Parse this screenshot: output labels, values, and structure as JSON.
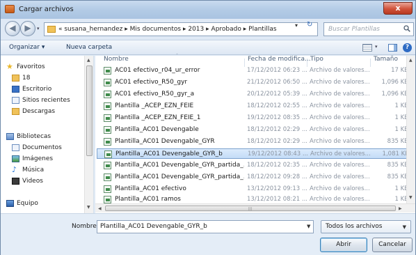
{
  "window": {
    "title": "Cargar archivos",
    "close_glyph": "x"
  },
  "address": {
    "crumbs": [
      "« susana_hernandez",
      "Mis documentos",
      "2013",
      "Aprobado",
      "Plantillas"
    ],
    "separator": "▸",
    "search_placeholder": "Buscar Plantillas"
  },
  "toolbar": {
    "organize_label": "Organizar ▾",
    "new_folder_label": "Nueva carpeta",
    "help_glyph": "?"
  },
  "nav": [
    {
      "label": "Favoritos",
      "icon": "star-icon"
    },
    {
      "label": "18",
      "icon": "folder-icon"
    },
    {
      "label": "Escritorio",
      "icon": "desktop-icon"
    },
    {
      "label": "Sitios recientes",
      "icon": "recent-places-icon"
    },
    {
      "label": "Descargas",
      "icon": "downloads-icon"
    },
    {
      "label": "Bibliotecas",
      "icon": "libraries-icon"
    },
    {
      "label": "Documentos",
      "icon": "documents-icon"
    },
    {
      "label": "Imágenes",
      "icon": "pictures-icon"
    },
    {
      "label": "Música",
      "icon": "music-icon"
    },
    {
      "label": "Videos",
      "icon": "videos-icon"
    },
    {
      "label": "Equipo",
      "icon": "computer-icon"
    }
  ],
  "columns": {
    "name": "Nombre",
    "date": "Fecha de modifica...",
    "type": "Tipo",
    "size": "Tamaño"
  },
  "files": [
    {
      "name": "AC01 efectivo_r04_ur_error",
      "date": "17/12/2012 06:23 ...",
      "type": "Archivo de valores...",
      "size": "17 KB"
    },
    {
      "name": "AC01 efectivo_R50_gyr",
      "date": "21/12/2012 06:50 ...",
      "type": "Archivo de valores...",
      "size": "1,096 KB"
    },
    {
      "name": "AC01 efectivo_R50_gyr_a",
      "date": "20/12/2012 05:39 ...",
      "type": "Archivo de valores...",
      "size": "1,096 KB"
    },
    {
      "name": "Plantilla _ACEP_EZN_FEIE",
      "date": "18/12/2012 02:55 ...",
      "type": "Archivo de valores...",
      "size": "1 KB"
    },
    {
      "name": "Plantilla _ACEP_EZN_FEIE_1",
      "date": "19/12/2012 08:35 ...",
      "type": "Archivo de valores...",
      "size": "1 KB"
    },
    {
      "name": "Plantilla_AC01 Devengable",
      "date": "18/12/2012 02:29 ...",
      "type": "Archivo de valores...",
      "size": "1 KB"
    },
    {
      "name": "Plantilla_AC01 Devengable_GYR",
      "date": "18/12/2012 02:29 ...",
      "type": "Archivo de valores...",
      "size": "835 KB"
    },
    {
      "name": "Plantilla_AC01 Devengable_GYR_b",
      "date": "19/12/2012 08:43 ...",
      "type": "Archivo de valores...",
      "size": "1,081 KB",
      "selected": true
    },
    {
      "name": "Plantilla_AC01 Devengable_GYR_partida_...",
      "date": "18/12/2012 02:35 ...",
      "type": "Archivo de valores...",
      "size": "835 KB"
    },
    {
      "name": "Plantilla_AC01 Devengable_GYR_partida_...",
      "date": "18/12/2012 09:28 ...",
      "type": "Archivo de valores...",
      "size": "835 KB"
    },
    {
      "name": "Plantilla_AC01 efectivo",
      "date": "13/12/2012 09:13 ...",
      "type": "Archivo de valores...",
      "size": "1 KB"
    },
    {
      "name": "Plantilla_AC01 ramos",
      "date": "13/12/2012 08:21 ...",
      "type": "Archivo de valores...",
      "size": "1 KB"
    }
  ],
  "bottom": {
    "filename_label": "Nombre:",
    "filename_value": "Plantilla_AC01 Devengable_GYR_b",
    "filetype_value": "Todos los archivos",
    "open_label": "Abrir",
    "cancel_label": "Cancelar"
  }
}
